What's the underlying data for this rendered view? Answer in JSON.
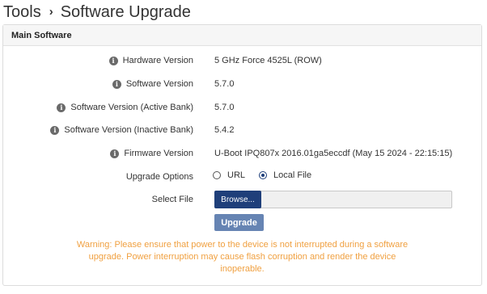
{
  "breadcrumb": {
    "parent": "Tools",
    "separator": "›",
    "current": "Software Upgrade"
  },
  "panel": {
    "title": "Main Software"
  },
  "fields": [
    {
      "label": "Hardware Version",
      "value": "5 GHz Force 4525L (ROW)"
    },
    {
      "label": "Software Version",
      "value": "5.7.0"
    },
    {
      "label": "Software Version (Active Bank)",
      "value": "5.7.0"
    },
    {
      "label": "Software Version (Inactive Bank)",
      "value": "5.4.2"
    },
    {
      "label": "Firmware Version",
      "value": "U-Boot IPQ807x 2016.01ga5eccdf (May 15 2024 - 22:15:15)"
    }
  ],
  "upgrade_options": {
    "label": "Upgrade Options",
    "options": [
      {
        "label": "URL",
        "selected": false
      },
      {
        "label": "Local File",
        "selected": true
      }
    ]
  },
  "select_file": {
    "label": "Select File",
    "browse_label": "Browse..."
  },
  "upgrade_button": {
    "label": "Upgrade"
  },
  "warning": "Warning: Please ensure that power to the device is not interrupted during a software upgrade. Power interruption may cause flash corruption and render the device inoperable.",
  "colors": {
    "primary": "#1f3f7a",
    "button": "#6684b3",
    "warning": "#f0a040"
  },
  "icons": {
    "info": "info-circle-icon"
  }
}
